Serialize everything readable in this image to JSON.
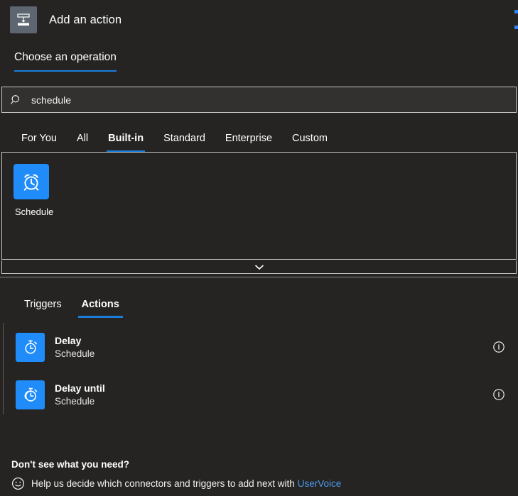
{
  "header": {
    "icon": "insert-action-icon",
    "title": "Add an action"
  },
  "section": {
    "title": "Choose an operation"
  },
  "search": {
    "icon": "search-icon",
    "value": "schedule",
    "placeholder": "Search connectors and actions"
  },
  "category_tabs": [
    {
      "label": "For You",
      "active": false
    },
    {
      "label": "All",
      "active": false
    },
    {
      "label": "Built-in",
      "active": true
    },
    {
      "label": "Standard",
      "active": false
    },
    {
      "label": "Enterprise",
      "active": false
    },
    {
      "label": "Custom",
      "active": false
    }
  ],
  "connectors": [
    {
      "label": "Schedule",
      "icon": "alarm-clock-icon",
      "color": "#1f8cf9"
    }
  ],
  "collapse": {
    "icon": "chevron-down-icon"
  },
  "operation_tabs": [
    {
      "label": "Triggers",
      "active": false
    },
    {
      "label": "Actions",
      "active": true
    }
  ],
  "actions": [
    {
      "title": "Delay",
      "subtitle": "Schedule",
      "icon": "stopwatch-icon",
      "color": "#1f8cf9",
      "info": "info-icon"
    },
    {
      "title": "Delay until",
      "subtitle": "Schedule",
      "icon": "stopwatch-until-icon",
      "color": "#1f8cf9",
      "info": "info-icon"
    }
  ],
  "footer": {
    "title": "Don't see what you need?",
    "icon": "smiley-face-icon",
    "text": "Help us decide which connectors and triggers to add next with",
    "link": "UserVoice"
  },
  "colors": {
    "background": "#252423",
    "accent": "#1a7ddc",
    "tile_blue": "#1f8cf9",
    "link": "#4a9ae8",
    "border": "#c8c6c4"
  }
}
